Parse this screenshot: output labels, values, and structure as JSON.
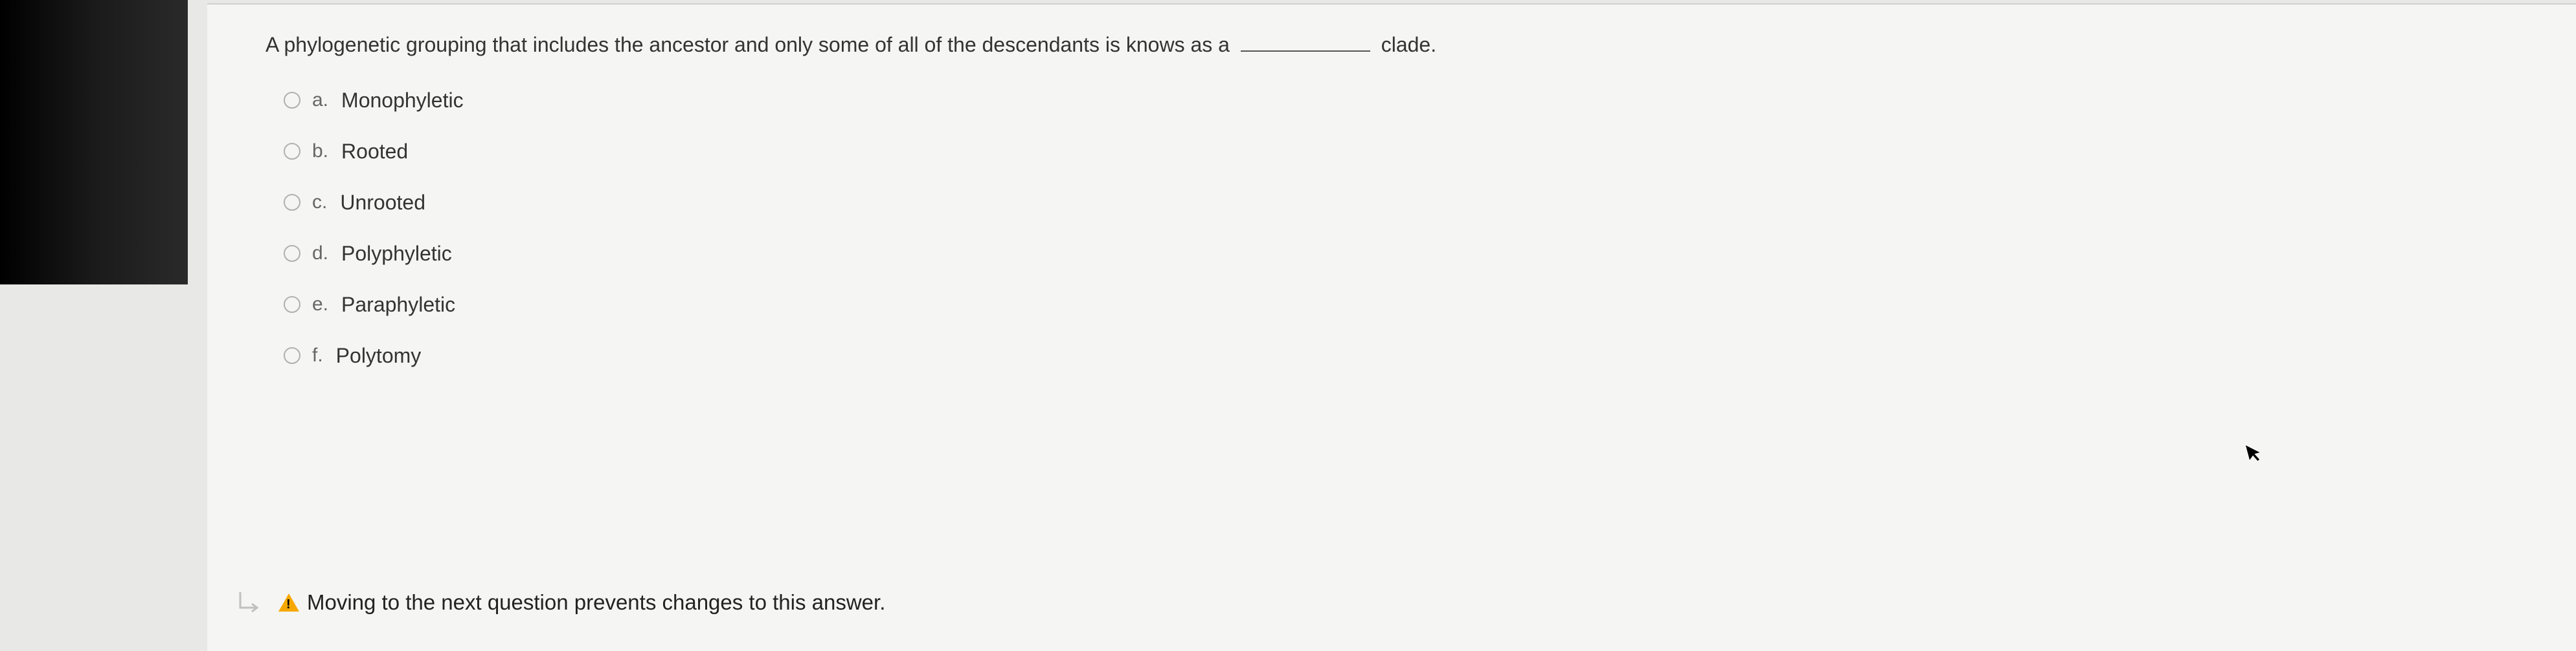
{
  "question": {
    "text_before": "A phylogenetic grouping that includes the ancestor and only some of all of the descendants is knows as a",
    "text_after": "clade.",
    "options": [
      {
        "letter": "a.",
        "text": "Monophyletic"
      },
      {
        "letter": "b.",
        "text": "Rooted"
      },
      {
        "letter": "c.",
        "text": "Unrooted"
      },
      {
        "letter": "d.",
        "text": "Polyphyletic"
      },
      {
        "letter": "e.",
        "text": "Paraphyletic"
      },
      {
        "letter": "f.",
        "text": "Polytomy"
      }
    ]
  },
  "warning": {
    "message": "Moving to the next question prevents changes to this answer."
  }
}
